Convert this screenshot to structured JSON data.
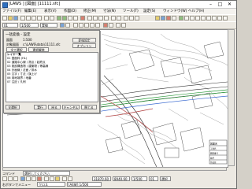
{
  "window": {
    "title": "[LAWS ] [図面] [11111.sfc]",
    "min_glyph": "–",
    "max_glyph": "□",
    "close_glyph": "✕"
  },
  "menu": [
    "ファイル(F)",
    "編集(E)",
    "表示(V)",
    "作図(D)",
    "修正(M)",
    "寸法(N)",
    "ツール(T)",
    "設定(S)",
    "ウィンドウ(W)",
    "ヘルプ(H)"
  ],
  "toolbar": {
    "layer_value": "01",
    "scale_value": "1/500",
    "linetype_value": "実線"
  },
  "panel": {
    "title": "一括変換 - 設定",
    "row1_label": "図面",
    "row1_value": "1:500",
    "row2_label": "対象図面",
    "row2_value": "c:\\LAWS\\data\\11111.sfc",
    "button_a": "全て選択",
    "button_b": "選択解除",
    "button_c": "変換設定",
    "button_d": "オプション",
    "list_header": "レイヤ一覧",
    "list": [
      "01 図面枠 (HL)",
      "02 道路中心線 / 測点 / 起終点",
      "03 既設構造物 / 建築物 / 等高線",
      "04 計画線 / 法面 / 排水",
      "05 文字 / 寸法 / 旗上げ",
      "06 用地境界 / 地番",
      "07 注記 / 凡例"
    ],
    "footer_a": "全選択",
    "footer_b": "実行",
    "footer_c": "戻る",
    "footer_d": "キャンセル",
    "footer_e": "閉じる"
  },
  "title_block": {
    "heading": "図面名",
    "lines": [
      "工事名",
      "図面番号",
      "縮尺",
      "作成日"
    ]
  },
  "status": {
    "prompt_label": "コマンド",
    "prompt_value": "選択してください",
    "coord_x": "31870.60",
    "coord_y": "8940.60",
    "scale": "1/500",
    "layer": "01",
    "mode": "選択",
    "bottom_hint": "右ボタンでメニュー",
    "bottom_field": "クロス",
    "bottom_value": "[A4縦] 1/500"
  }
}
